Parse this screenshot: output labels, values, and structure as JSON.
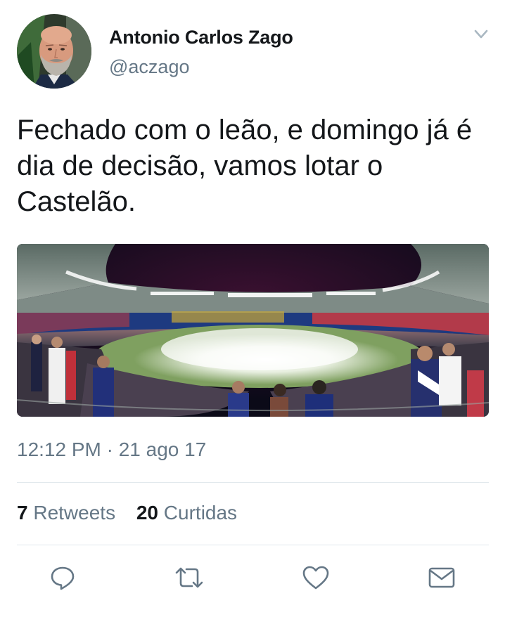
{
  "author": {
    "name": "Antonio Carlos Zago",
    "handle": "@aczago"
  },
  "tweet": {
    "text": "Fechado com o leão, e domingo já é dia de decisão, vamos lotar o Castelão.",
    "timestamp": "12:12 PM · 21 ago 17"
  },
  "stats": {
    "retweets_count": "7",
    "retweets_label": "Retweets",
    "likes_count": "20",
    "likes_label": "Curtidas"
  },
  "icons": {
    "menu": "chevron-down-icon",
    "reply": "reply-icon",
    "retweet": "retweet-icon",
    "like": "heart-icon",
    "message": "envelope-icon"
  },
  "colors": {
    "text": "#14171a",
    "secondary": "#657786",
    "divider": "#e1e8ed",
    "icon": "#657786"
  }
}
